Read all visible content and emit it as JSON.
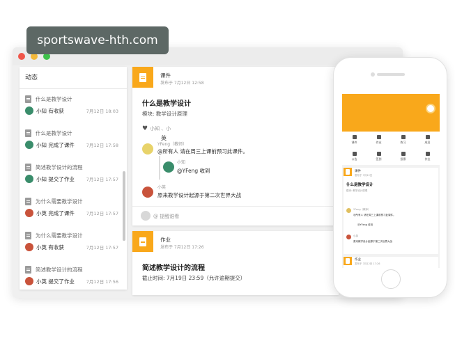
{
  "watermark": "sportswave-hth.com",
  "feed": {
    "title": "动态",
    "items": [
      {
        "title": "什么是教学设计",
        "text": "小知 有收获",
        "time": "7月12日 18:03",
        "avatar": "green"
      },
      {
        "title": "什么是教学设计",
        "text": "小知 完成了课件",
        "time": "7月12日 17:58",
        "avatar": "green"
      },
      {
        "title": "简述教学设计的流程",
        "text": "小知 提交了作业",
        "time": "7月12日 17:57",
        "avatar": "green"
      },
      {
        "title": "为什么需要教学设计",
        "text": "小英 完成了课件",
        "time": "7月12日 17:57",
        "avatar": "red"
      },
      {
        "title": "为什么需要教学设计",
        "text": "小英 有收获",
        "time": "7月12日 17:57",
        "avatar": "red"
      },
      {
        "title": "简述教学设计的流程",
        "text": "小英 提交了作业",
        "time": "7月12日 17:56",
        "avatar": "red"
      }
    ]
  },
  "card1": {
    "type": "课件",
    "meta": "发布于 7月12日 12:58",
    "heading": "什么是教学设计",
    "module": "模块: 教学设计原理",
    "likes": "小知 、小",
    "likes_extra": "英",
    "comment1": {
      "name": "YFeng（教师）",
      "text": "@所有人 请在周三上课前预习此课件。"
    },
    "reply": {
      "name": "小知",
      "text": "@YFeng 收到"
    },
    "comment2": {
      "name": "小英",
      "text": "原来教学设计起源于第二次世界大战"
    },
    "input_placeholder": "@ 提醒谁看"
  },
  "card2": {
    "type": "作业",
    "meta": "发布于 7月12日 17:26",
    "heading": "简述教学设计的流程",
    "due": "截止时间: 7月19日 23:59（允许逾期提交）"
  },
  "phone": {
    "grid": [
      "课件",
      "作业",
      "练习",
      "成员",
      "公告",
      "签到",
      "投票",
      "作业"
    ],
    "card1_type": "课件",
    "card1_meta": "发布于 7月12日",
    "card1_heading": "什么是教学设计",
    "card1_module": "模块: 教学设计原理",
    "card1_c1": "YFeng（教师）",
    "card1_c1_text": "@所有人 请在周三上课前预习此课件。",
    "card1_reply": "@YFeng 收到",
    "card1_c2": "小英",
    "card1_c2_text": "原来教学设计起源于第二次世界大战",
    "card2_type": "作业",
    "card2_meta": "发布于 7月12日 17:26"
  },
  "colors": {
    "accent": "#f9a81b",
    "close": "#f0564a",
    "minimize": "#f4b93a",
    "maximize": "#3ec14b"
  }
}
